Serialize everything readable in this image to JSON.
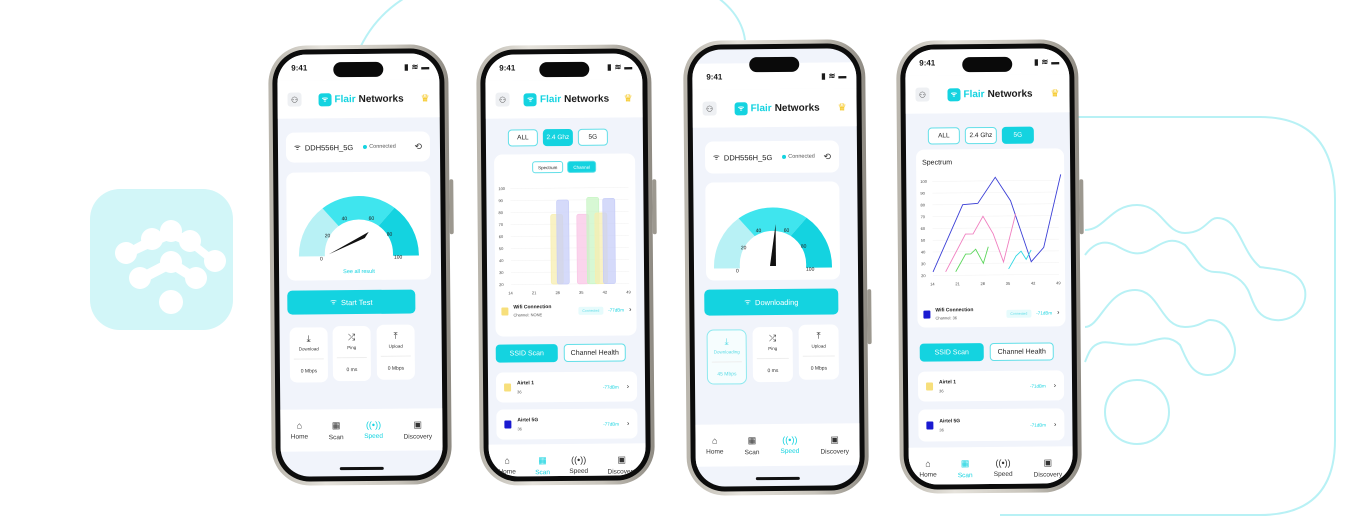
{
  "brand": {
    "name_part1": "Flair",
    "name_part2": "Networks",
    "trademark": "®"
  },
  "colors": {
    "accent": "#14d3e0",
    "accent_light": "#d2f6f8",
    "bg_screen": "#f1f4fb",
    "crown": "#f5c518",
    "deco_outline": "#b8f1f5"
  },
  "status_bar": {
    "time": "9:41"
  },
  "icons": {
    "avatar": "user-icon",
    "crown": "crown-icon",
    "wifi": "wifi-icon",
    "history": "history-icon",
    "download": "download-icon",
    "ping": "shuffle-icon",
    "upload": "upload-icon",
    "chevron": "chevron-right-icon"
  },
  "nav": {
    "items": [
      {
        "label": "Home",
        "icon": "home-icon"
      },
      {
        "label": "Scan",
        "icon": "qr-scan-icon"
      },
      {
        "label": "Speed",
        "icon": "signal-broadcast-icon"
      },
      {
        "label": "Discovery",
        "icon": "devices-icon"
      }
    ]
  },
  "phone1": {
    "ssid": "DDH556H_5G",
    "connection_status": "Connected",
    "gauge": {
      "ticks": [
        "0",
        "20",
        "40",
        "60",
        "80",
        "100"
      ],
      "value": 58
    },
    "see_all": "See all result",
    "start_button": "Start Test",
    "stats": [
      {
        "label": "Download",
        "value": "0 Mbps"
      },
      {
        "label": "Ping",
        "value": "0 ms"
      },
      {
        "label": "Upload",
        "value": "0 Mbps"
      }
    ],
    "active_nav": "Speed"
  },
  "phone2": {
    "bands": [
      "ALL",
      "2.4 Ghz",
      "5G"
    ],
    "active_band": "2.4 Ghz",
    "view_tabs": [
      "Spectrum",
      "Channel"
    ],
    "active_view": "Channel",
    "chart_data": {
      "type": "bar",
      "title": "Channel",
      "y_ticks": [
        "100",
        "90",
        "80",
        "70",
        "60",
        "50",
        "40",
        "30",
        "20"
      ],
      "x_ticks": [
        "14",
        "21",
        "28",
        "35",
        "42",
        "49"
      ],
      "ylim": [
        20,
        100
      ],
      "bars": [
        {
          "name": "yellow-1",
          "color": "#f7eeb0",
          "x0": 2.0,
          "x1": 2.6,
          "value": 78
        },
        {
          "name": "blue-1",
          "color": "#c7cdf8",
          "x0": 2.3,
          "x1": 2.9,
          "value": 90
        },
        {
          "name": "pink-1",
          "color": "#f9c6e6",
          "x0": 3.3,
          "x1": 3.9,
          "value": 78
        },
        {
          "name": "green-1",
          "color": "#c9f5c6",
          "x0": 3.8,
          "x1": 4.4,
          "value": 92
        },
        {
          "name": "yellow-2",
          "color": "#f7eeb0",
          "x0": 4.2,
          "x1": 4.8,
          "value": 79
        },
        {
          "name": "blue-2",
          "color": "#c7cdf8",
          "x0": 4.6,
          "x1": 5.2,
          "value": 91
        }
      ]
    },
    "current": {
      "name": "Wifi Connection",
      "channel": "Channel: NONE",
      "badge": "Connected",
      "signal": "-77dBm",
      "color": "#f7df7b"
    },
    "tabs": [
      "SSID Scan",
      "Channel Health"
    ],
    "active_tab": "SSID Scan",
    "networks": [
      {
        "name": "Airtel 1",
        "channel": "36",
        "signal": "-77dBm",
        "color": "#f7df7b"
      },
      {
        "name": "Airtel 5G",
        "channel": "36",
        "signal": "-77dBm",
        "color": "#1a1ad1"
      }
    ],
    "active_nav": "Scan"
  },
  "phone3": {
    "ssid": "DDH556H_5G",
    "connection_status": "Connected",
    "gauge": {
      "ticks": [
        "0",
        "20",
        "40",
        "60",
        "80",
        "100"
      ],
      "value": 48
    },
    "button": "Downloading",
    "stats": [
      {
        "label": "Downloading",
        "value": "45 Mbps",
        "active": true
      },
      {
        "label": "Ping",
        "value": "0 ms"
      },
      {
        "label": "Upload",
        "value": "0 Mbps"
      }
    ],
    "active_nav": "Speed"
  },
  "phone4": {
    "bands": [
      "ALL",
      "2.4 Ghz",
      "5G"
    ],
    "active_band": "5G",
    "chart_data": {
      "type": "line",
      "title": "Spectrum",
      "y_ticks": [
        "100",
        "90",
        "80",
        "70",
        "60",
        "50",
        "40",
        "30",
        "20"
      ],
      "x_ticks": [
        "14",
        "21",
        "28",
        "35",
        "42",
        "49"
      ],
      "ylim": [
        20,
        105
      ],
      "series": [
        {
          "name": "blue",
          "color": "#3b3fd6",
          "points": [
            [
              0,
              23
            ],
            [
              1.2,
              80
            ],
            [
              1.8,
              81
            ],
            [
              2.5,
              103
            ],
            [
              3.1,
              83
            ],
            [
              3.9,
              31
            ],
            [
              4.4,
              43
            ],
            [
              5.1,
              105
            ]
          ]
        },
        {
          "name": "pink",
          "color": "#f07fc0",
          "points": [
            [
              0.5,
              23
            ],
            [
              1.3,
              55
            ],
            [
              1.6,
              55
            ],
            [
              2.0,
              70
            ],
            [
              2.4,
              55
            ],
            [
              2.8,
              31
            ],
            [
              3.3,
              72
            ]
          ]
        },
        {
          "name": "green",
          "color": "#5cd65c",
          "points": [
            [
              0.9,
              23
            ],
            [
              1.3,
              38
            ],
            [
              1.5,
              38
            ],
            [
              1.7,
              42
            ],
            [
              2.0,
              30
            ],
            [
              2.2,
              44
            ]
          ]
        },
        {
          "name": "cyan",
          "color": "#2fd7e3",
          "points": [
            [
              3.0,
              25
            ],
            [
              3.3,
              36
            ],
            [
              3.5,
              40
            ],
            [
              3.7,
              33
            ],
            [
              3.9,
              41
            ]
          ]
        }
      ]
    },
    "current": {
      "name": "Wifi Connection",
      "channel": "Channel: 36",
      "badge": "Connected",
      "signal": "-71dBm",
      "color": "#1a1ad1"
    },
    "tabs": [
      "SSID Scan",
      "Channel Health"
    ],
    "active_tab": "SSID Scan",
    "networks": [
      {
        "name": "Airtel 1",
        "channel": "36",
        "signal": "-71dBm",
        "color": "#f7df7b"
      },
      {
        "name": "Airtel 5G",
        "channel": "36",
        "signal": "-71dBm",
        "color": "#1a1ad1"
      }
    ],
    "active_nav": "Scan"
  }
}
